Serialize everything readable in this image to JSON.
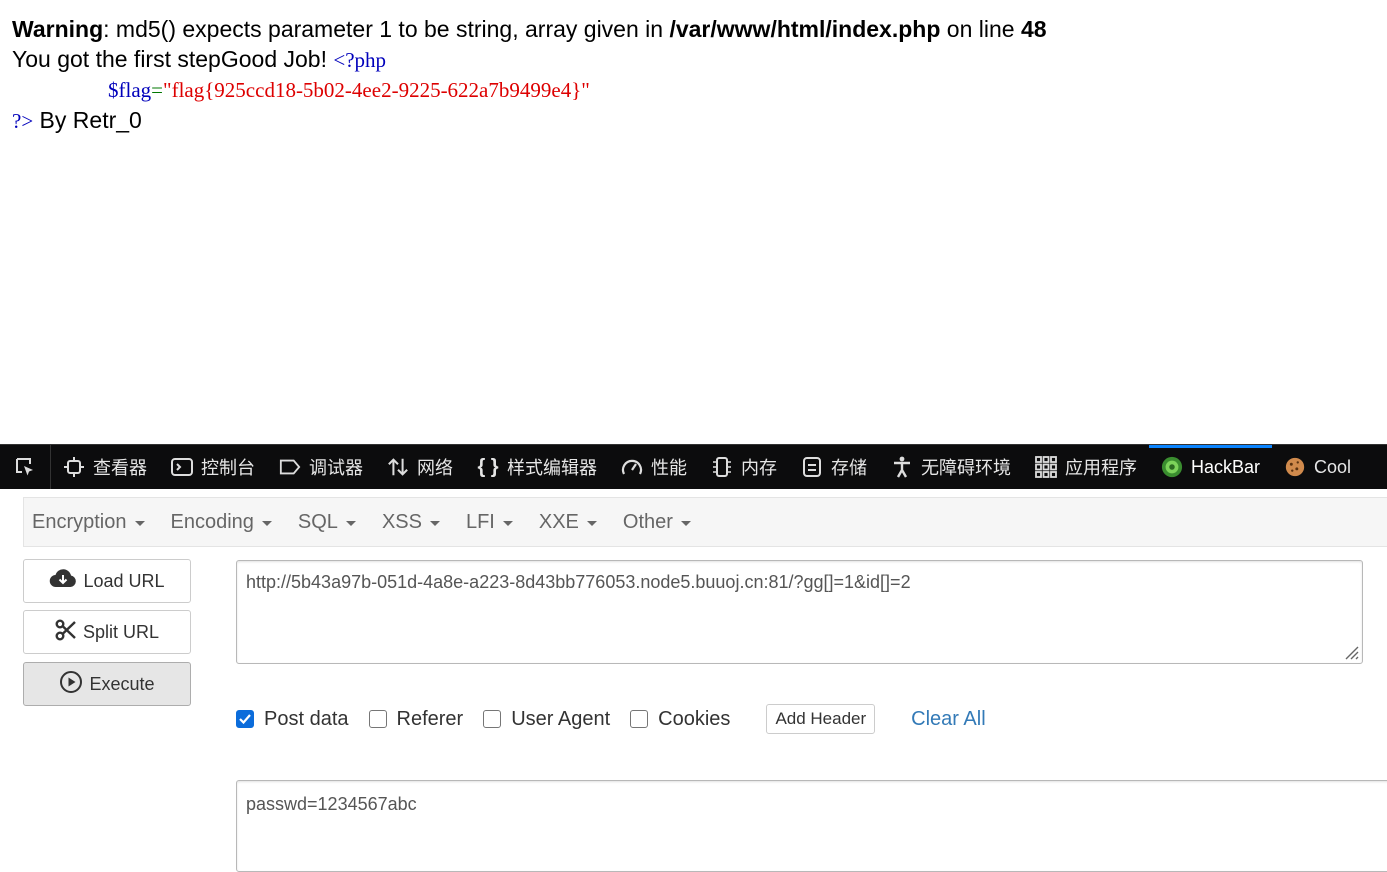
{
  "page": {
    "warning_label": "Warning",
    "warning_message": ": md5() expects parameter 1 to be string, array given in ",
    "warning_file": "/var/www/html/index.php",
    "warning_online": " on line ",
    "warning_line": "48",
    "step_text": "You got the first stepGood Job! ",
    "php_open": "<?php",
    "flag_var": "$flag",
    "flag_eq": "=",
    "flag_value": "\"flag{925ccd18-5b02-4ee2-9225-622a7b9499e4}\"",
    "php_close": "?>",
    "by_text": " By Retr_0"
  },
  "devtools": {
    "tabs": [
      {
        "label": "查看器",
        "icon": "inspector-icon"
      },
      {
        "label": "控制台",
        "icon": "console-icon"
      },
      {
        "label": "调试器",
        "icon": "debugger-icon"
      },
      {
        "label": "网络",
        "icon": "network-icon"
      },
      {
        "label": "样式编辑器",
        "icon": "style-editor-icon"
      },
      {
        "label": "性能",
        "icon": "performance-icon"
      },
      {
        "label": "内存",
        "icon": "memory-icon"
      },
      {
        "label": "存储",
        "icon": "storage-icon"
      },
      {
        "label": "无障碍环境",
        "icon": "accessibility-icon"
      },
      {
        "label": "应用程序",
        "icon": "application-icon"
      },
      {
        "label": "HackBar",
        "icon": "hackbar-icon"
      },
      {
        "label": "Cool",
        "icon": "cookie-icon"
      }
    ]
  },
  "hackbar": {
    "menu": [
      "Encryption",
      "Encoding",
      "SQL",
      "XSS",
      "LFI",
      "XXE",
      "Other"
    ],
    "load_url": "Load URL",
    "split_url": "Split URL",
    "execute": "Execute",
    "url_value": "http://5b43a97b-051d-4a8e-a223-8d43bb776053.node5.buuoj.cn:81/?gg[]=1&id[]=2",
    "options": {
      "post_data": "Post data",
      "referer": "Referer",
      "user_agent": "User Agent",
      "cookies": "Cookies"
    },
    "add_header": "Add Header",
    "clear_all": "Clear All",
    "post_value": "passwd=1234567abc",
    "accent_color": "#0b6cdb"
  }
}
